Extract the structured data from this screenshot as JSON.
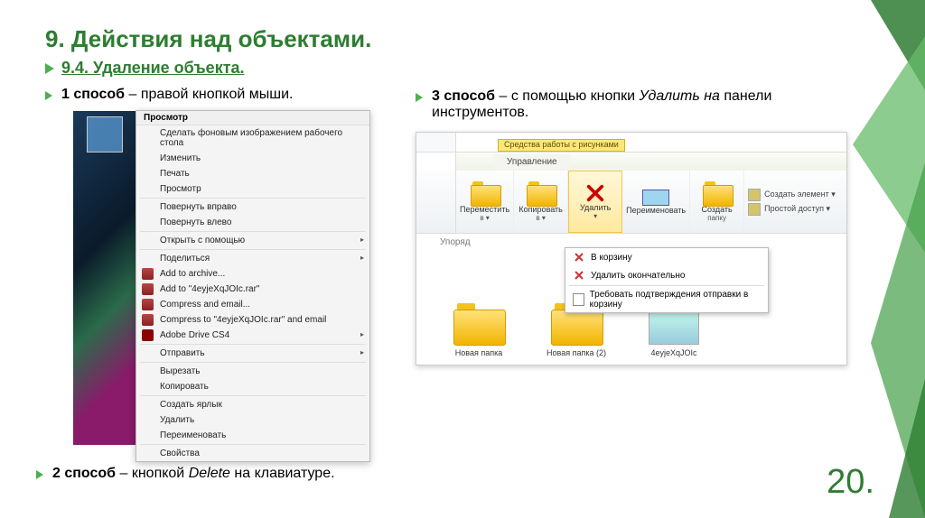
{
  "title": "9. Действия над объектами.",
  "subtitle": "9.4. Удаление объекта.",
  "method1": {
    "bold": "1 способ",
    "dash": " – ",
    "rest": "правой кнопкой мыши."
  },
  "method2": {
    "bold": "2 способ",
    "dash": " – ",
    "rest_pre": "кнопкой ",
    "rest_em": "Delete",
    "rest_post": " на клавиатуре."
  },
  "method3": {
    "bold": "3 способ",
    "dash": " – ",
    "rest_pre": "с помощью кнопки ",
    "rest_em": "Удалить на",
    "rest_post": " панели инструментов."
  },
  "context_menu": {
    "header": "Просмотр",
    "items": [
      "Сделать фоновым изображением рабочего стола",
      "Изменить",
      "Печать",
      "Просмотр"
    ],
    "rotate": [
      "Повернуть вправо",
      "Повернуть влево"
    ],
    "open_with": "Открыть с помощью",
    "share": "Поделиться",
    "archive": [
      "Add to archive...",
      "Add to \"4eyjeXqJOIc.rar\"",
      "Compress and email...",
      "Compress to \"4eyjeXqJOIc.rar\" and email"
    ],
    "adobe": "Adobe Drive CS4",
    "send": "Отправить",
    "cutcopy": [
      "Вырезать",
      "Копировать"
    ],
    "shortcut": "Создать ярлык",
    "delete": "Удалить",
    "rename": "Переименовать",
    "props": "Свойства"
  },
  "ribbon": {
    "context_tab": "Средства работы с рисунками",
    "subtab": "Управление",
    "buttons": {
      "move": {
        "label": "Переместить",
        "sub": "в ▾"
      },
      "copy": {
        "label": "Копировать",
        "sub": "в ▾"
      },
      "delete": {
        "label": "Удалить",
        "sub": "▾"
      },
      "rename": {
        "label": "Переименовать"
      },
      "newfolder": {
        "label": "Создать",
        "sub": "папку"
      }
    },
    "side": {
      "new_item": "Создать элемент ▾",
      "easy_access": "Простой доступ ▾"
    },
    "group_org": "Упоряд",
    "dropdown": {
      "recycle": "В корзину",
      "perm": "Удалить окончательно",
      "confirm": "Требовать подтверждения отправки в корзину"
    }
  },
  "explorer": {
    "files": [
      {
        "name": "Новая папка",
        "type": "folder"
      },
      {
        "name": "Новая папка (2)",
        "type": "folder"
      },
      {
        "name": "4eyjeXqJOIc",
        "type": "image"
      }
    ]
  },
  "page_number": "20."
}
